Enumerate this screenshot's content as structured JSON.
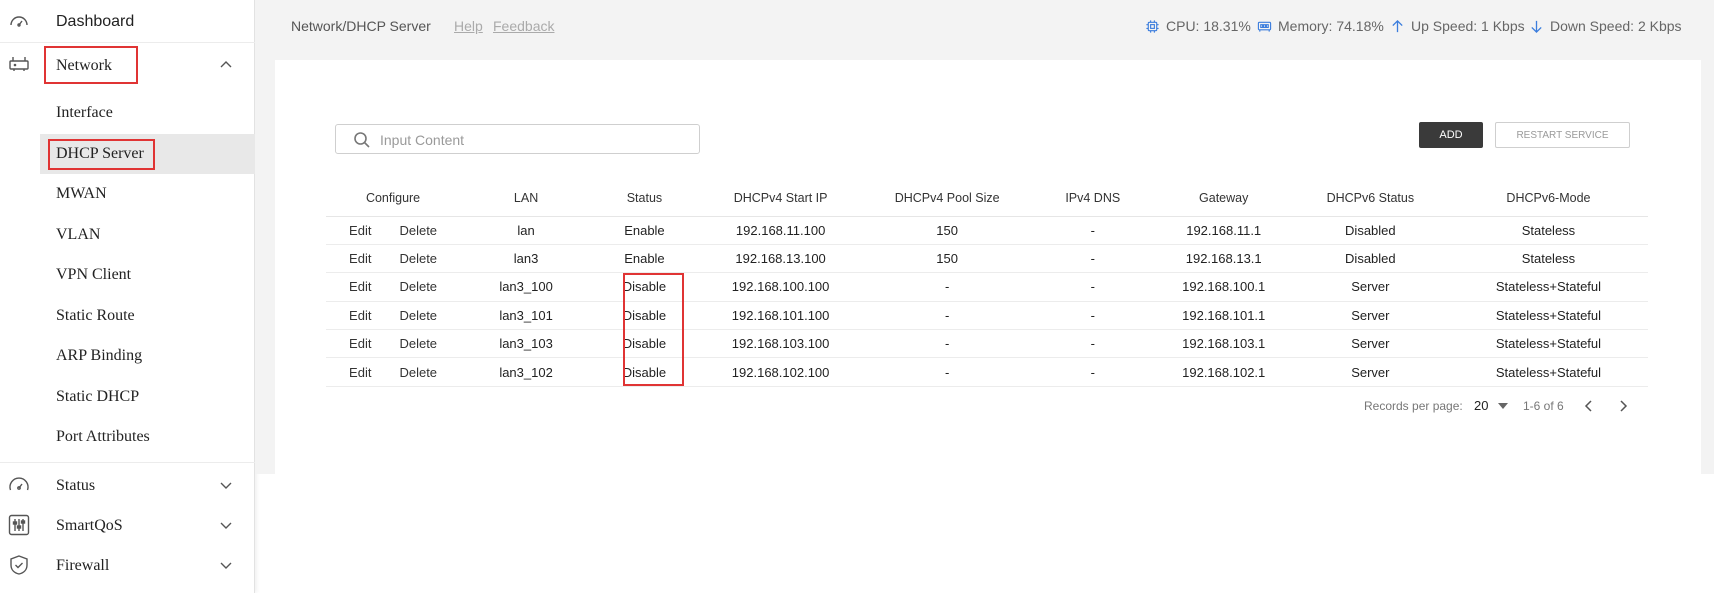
{
  "sidebar": {
    "dashboard": {
      "label": "Dashboard",
      "icon": "dashboard-icon"
    },
    "network": {
      "label": "Network",
      "icon": "router-icon",
      "expanded": true
    },
    "network_items": [
      {
        "label": "Interface"
      },
      {
        "label": "DHCP Server",
        "active": true
      },
      {
        "label": "MWAN"
      },
      {
        "label": "VLAN"
      },
      {
        "label": "VPN Client"
      },
      {
        "label": "Static Route"
      },
      {
        "label": "ARP Binding"
      },
      {
        "label": "Static DHCP"
      },
      {
        "label": "Port Attributes"
      }
    ],
    "status": {
      "label": "Status",
      "icon": "gauge-icon"
    },
    "smartqos": {
      "label": "SmartQoS",
      "icon": "sliders-icon"
    },
    "firewall": {
      "label": "Firewall",
      "icon": "shield-icon"
    }
  },
  "header": {
    "breadcrumb": "Network/DHCP Server",
    "help": "Help",
    "feedback": "Feedback",
    "cpu": "CPU: 18.31%",
    "memory": "Memory: 74.18%",
    "up_speed": "Up Speed: 1 Kbps",
    "down_speed": "Down Speed: 2 Kbps"
  },
  "toolbar": {
    "search_placeholder": "Input Content",
    "add_label": "ADD",
    "restart_label": "RESTART SERVICE"
  },
  "table": {
    "columns": [
      "Configure",
      "LAN",
      "Status",
      "DHCPv4 Start IP",
      "DHCPv4 Pool Size",
      "IPv4 DNS",
      "Gateway",
      "DHCPv6 Status",
      "DHCPv6-Mode"
    ],
    "edit_label": "Edit",
    "delete_label": "Delete",
    "rows": [
      {
        "lan": "lan",
        "status": "Enable",
        "start_ip": "192.168.11.100",
        "pool_size": "150",
        "dns": "-",
        "gateway": "192.168.11.1",
        "v6_status": "Disabled",
        "v6_mode": "Stateless"
      },
      {
        "lan": "lan3",
        "status": "Enable",
        "start_ip": "192.168.13.100",
        "pool_size": "150",
        "dns": "-",
        "gateway": "192.168.13.1",
        "v6_status": "Disabled",
        "v6_mode": "Stateless"
      },
      {
        "lan": "lan3_100",
        "status": "Disable",
        "start_ip": "192.168.100.100",
        "pool_size": "-",
        "dns": "-",
        "gateway": "192.168.100.1",
        "v6_status": "Server",
        "v6_mode": "Stateless+Stateful"
      },
      {
        "lan": "lan3_101",
        "status": "Disable",
        "start_ip": "192.168.101.100",
        "pool_size": "-",
        "dns": "-",
        "gateway": "192.168.101.1",
        "v6_status": "Server",
        "v6_mode": "Stateless+Stateful"
      },
      {
        "lan": "lan3_103",
        "status": "Disable",
        "start_ip": "192.168.103.100",
        "pool_size": "-",
        "dns": "-",
        "gateway": "192.168.103.1",
        "v6_status": "Server",
        "v6_mode": "Stateless+Stateful"
      },
      {
        "lan": "lan3_102",
        "status": "Disable",
        "start_ip": "192.168.102.100",
        "pool_size": "-",
        "dns": "-",
        "gateway": "192.168.102.1",
        "v6_status": "Server",
        "v6_mode": "Stateless+Stateful"
      }
    ]
  },
  "pagination": {
    "records_label": "Records per page:",
    "per_page": "20",
    "range": "1-6 of 6"
  },
  "colors": {
    "accent": "#3b7ddd",
    "highlight_box": "#e03434",
    "primary_button": "#3a3a3a"
  }
}
